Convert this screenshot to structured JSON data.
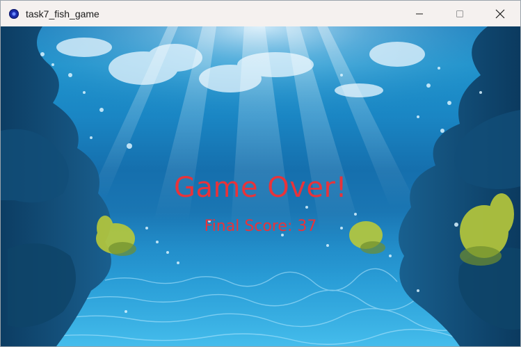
{
  "window": {
    "title": "task7_fish_game",
    "controls": [
      "minimize",
      "maximize",
      "close"
    ]
  },
  "game": {
    "scene": "underwater",
    "message": "Game Over!",
    "score_label": "Final Score: 37",
    "score": 37
  },
  "colors": {
    "message": "#e8333a",
    "water_deep": "#156fad",
    "water_light": "#34b1e4",
    "titlebar": "#f5f1ef"
  },
  "icons": [
    "app-icon",
    "minimize-icon",
    "maximize-icon",
    "close-icon"
  ]
}
